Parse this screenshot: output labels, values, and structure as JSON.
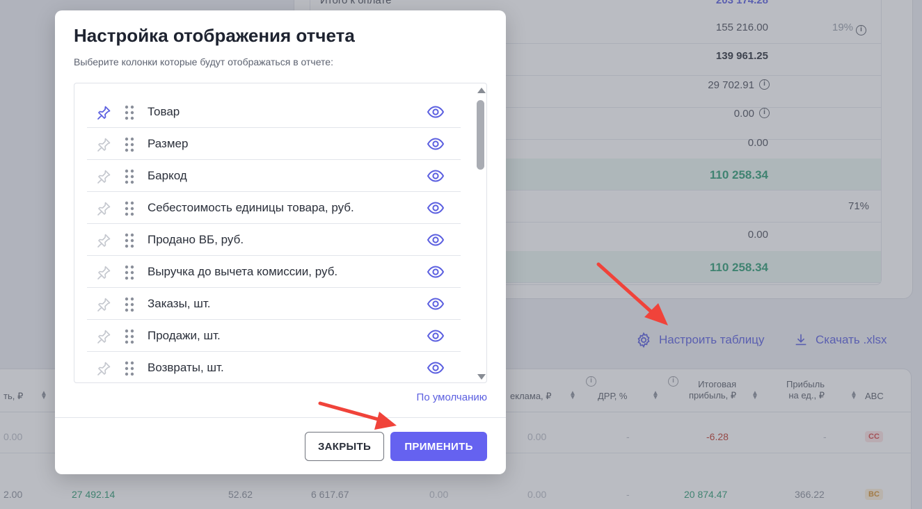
{
  "summary": {
    "top_label": "Итого к оплате",
    "top_value": "203 174.28",
    "rows": [
      {
        "value": "155 216.00",
        "pct": "19%",
        "info": true,
        "bold": false
      },
      {
        "value": "139 961.25",
        "bold": true
      },
      {
        "value": "29 702.91",
        "info": true
      },
      {
        "value": "0.00",
        "info": true
      },
      {
        "value": "0.00"
      },
      {
        "value": "110 258.34",
        "big": true
      },
      {
        "value": "",
        "pct": "71%"
      },
      {
        "value": "0.00"
      },
      {
        "value": "110 258.34",
        "big": true
      }
    ]
  },
  "actions": {
    "configure_label": "Настроить таблицу",
    "download_label": "Скачать .xlsx"
  },
  "table": {
    "headers": {
      "col_a": "ть, ₽",
      "col_ad": "еклама, ₽",
      "col_drr": "ДРР, %",
      "col_profit_1": "Итоговая",
      "col_profit_2": "прибыль, ₽",
      "col_unit_1": "Прибыль",
      "col_unit_2": "на ед., ₽",
      "col_abc": "ABC"
    },
    "rows": [
      {
        "a": "0.00",
        "ad": "0.00",
        "ad2": "0.00",
        "drr": "-",
        "profit": "-6.28",
        "unit": "-",
        "abc": "CC"
      },
      {
        "a": "2.00",
        "b": "27 492.14",
        "c": "52.62",
        "d": "6 617.67",
        "e": "0.00",
        "ad": "0.00",
        "drr": "-",
        "profit": "20 874.47",
        "unit": "366.22",
        "abc": "BC"
      }
    ]
  },
  "modal": {
    "title": "Настройка отображения отчета",
    "subtitle": "Выберите колонки которые будут отображаться в отчете:",
    "items": [
      {
        "label": "Товар",
        "pinned": true
      },
      {
        "label": "Размер",
        "pinned": false
      },
      {
        "label": "Баркод",
        "pinned": false
      },
      {
        "label": "Себестоимость единицы товара, руб.",
        "pinned": false
      },
      {
        "label": "Продано ВБ, руб.",
        "pinned": false
      },
      {
        "label": "Выручка до вычета комиссии, руб.",
        "pinned": false
      },
      {
        "label": "Заказы, шт.",
        "pinned": false
      },
      {
        "label": "Продажи, шт.",
        "pinned": false
      },
      {
        "label": "Возвраты, шт.",
        "pinned": false
      }
    ],
    "default_link": "По умолчанию",
    "close_label": "ЗАКРЫТЬ",
    "apply_label": "ПРИМЕНИТЬ"
  },
  "colors": {
    "accent": "#6562f0",
    "link": "#5b5fe0",
    "positive": "#2e9d74",
    "negative": "#c0392b",
    "arrow": "#f0433a"
  }
}
